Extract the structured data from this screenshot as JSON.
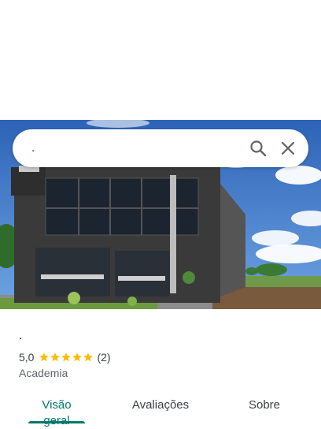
{
  "search": {
    "value": "."
  },
  "place": {
    "name": ".",
    "rating": "5,0",
    "stars": 5,
    "review_count": "(2)",
    "category": "Academia"
  },
  "tabs": [
    {
      "label": "Visão geral",
      "active": true
    },
    {
      "label": "Avaliações",
      "active": false
    },
    {
      "label": "Sobre",
      "active": false
    }
  ],
  "colors": {
    "accent": "#00796b",
    "star": "#fbbc04"
  }
}
